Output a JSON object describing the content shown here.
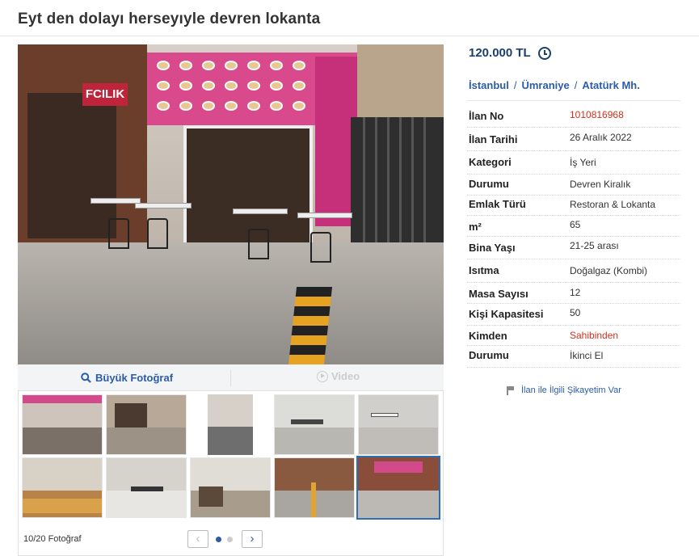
{
  "listing": {
    "title": "Eyt den dolayı herseyıyle devren lokanta"
  },
  "gallery": {
    "large_photo_label": "Büyük Fotoğraf",
    "video_label": "Video",
    "photo_counter": "10/20 Fotoğraf",
    "prev_icon": "chevron-left-icon",
    "next_icon": "chevron-right-icon",
    "pages": 2,
    "current_page": 1,
    "active_thumb_index": 9,
    "main_photo_sign": "FCILIK"
  },
  "price": {
    "value": "120.000 TL",
    "icon": "history-icon"
  },
  "location": {
    "city": "İstanbul",
    "district": "Ümraniye",
    "neighborhood": "Atatürk Mh.",
    "separator": "/"
  },
  "details": [
    {
      "key": "İlan No",
      "value": "1010816968",
      "color": "#d0301c"
    },
    {
      "key": "İlan Tarihi",
      "value": "26 Aralık 2022"
    },
    {
      "key": "Kategori",
      "value": "İş Yeri"
    },
    {
      "key": "Durumu",
      "value": "Devren Kiralık"
    },
    {
      "key": "Emlak Türü",
      "value": "Restoran & Lokanta"
    },
    {
      "key": "m²",
      "value": "65"
    },
    {
      "key": "Bina Yaşı",
      "value": "21-25 arası"
    },
    {
      "key": "Isıtma",
      "value": "Doğalgaz (Kombi)"
    },
    {
      "key": "Masa Sayısı",
      "value": "12"
    },
    {
      "key": "Kişi Kapasitesi",
      "value": "50"
    },
    {
      "key": "Kimden",
      "value": "Sahibinden",
      "color": "#d0301c"
    },
    {
      "key": "Durumu",
      "value": "İkinci El"
    }
  ],
  "complaint": {
    "label": "İlan ile İlgili Şikayetim Var",
    "icon": "flag-icon"
  },
  "colors": {
    "accent_blue": "#2a5ca8",
    "price_navy": "#1b3f6e",
    "red": "#d0301c"
  }
}
